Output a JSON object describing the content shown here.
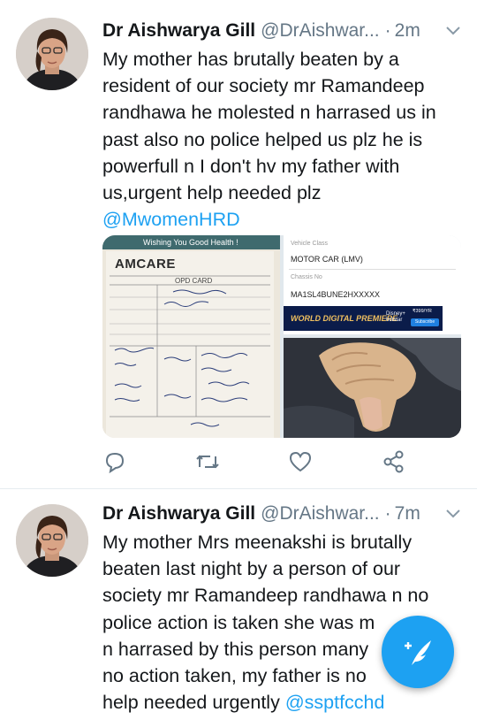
{
  "tweets": [
    {
      "name": "Dr Aishwarya Gill",
      "handle": "@DrAishwar...",
      "dot": "·",
      "time": "2m",
      "text": "My mother has brutally beaten by a resident of our society mr Ramandeep randhawa he molested n harrased us in past also no police helped us plz he is powerfull n I don't hv my father with us,urgent help needed plz",
      "mention": "@MwomenHRD",
      "media": {
        "card_title": "Wishing You Good Health !",
        "card_brand": "AMCARE",
        "card_heading": "OPD CARD",
        "vehicle_class_label": "Vehicle Class",
        "vehicle_class_value": "MOTOR CAR (LMV)",
        "chassis_label": "Chassis No",
        "chassis_value": "MA1SL4BUNE2HXXXXX",
        "banner_text": "WORLD DIGITAL PREMIERE",
        "banner_brand": "Disney+ hotstar",
        "banner_price": "₹399/YR",
        "banner_cta": "Subscribe"
      }
    },
    {
      "name": "Dr Aishwarya Gill",
      "handle": "@DrAishwar...",
      "dot": "·",
      "time": "7m",
      "text_lines": [
        "My mother Mrs meenakshi is brutally",
        "beaten last night by a person of our",
        "society mr Ramandeep randhawa n no",
        "police action is taken she was m",
        "n harrased by this person many",
        "no action taken, my father is no",
        "help needed urgently"
      ],
      "mention": "@ssptfcchd"
    }
  ],
  "icons": {
    "reply": "reply-icon",
    "retweet": "retweet-icon",
    "like": "heart-icon",
    "share": "share-icon",
    "more": "chevron-down-icon",
    "compose": "compose-tweet-icon"
  },
  "colors": {
    "accent": "#1da1f2",
    "muted": "#657786",
    "text": "#14171a"
  }
}
